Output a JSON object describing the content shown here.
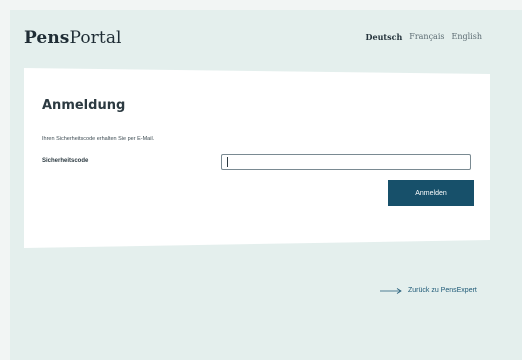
{
  "header": {
    "logo_bold": "Pens",
    "logo_regular": "Portal",
    "languages": [
      "Deutsch",
      "Français",
      "English"
    ],
    "active_language": "Deutsch"
  },
  "login": {
    "title": "Anmeldung",
    "info": "Ihren Sicherheitscode erhalten Sie per E-Mail.",
    "code_label": "Sicherheitscode",
    "code_value": "",
    "submit_label": "Anmelden"
  },
  "back_link": {
    "label": "Zurück zu PensExpert"
  },
  "colors": {
    "background": "#e4efed",
    "card": "#ffffff",
    "primary_button": "#17506a",
    "link": "#1f5a77"
  }
}
